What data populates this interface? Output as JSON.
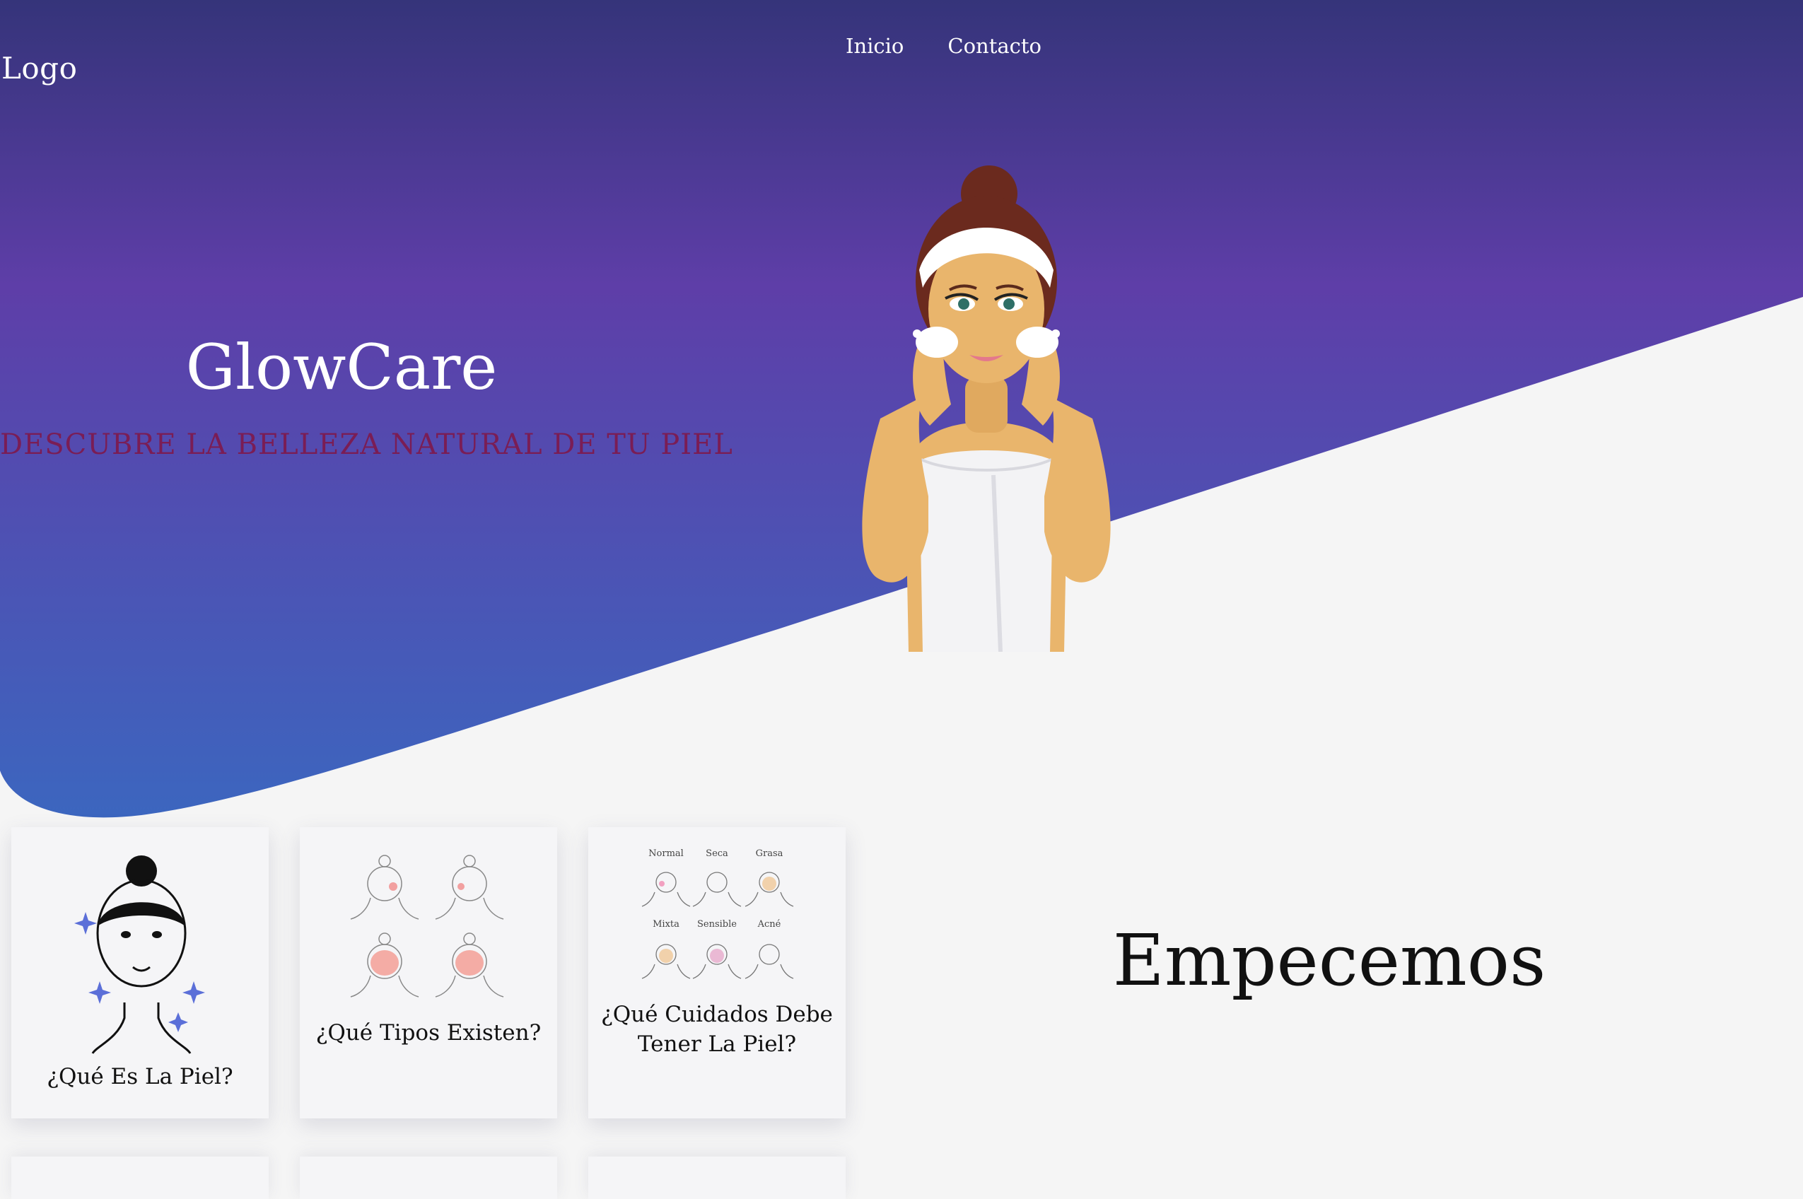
{
  "header": {
    "logo": "Logo",
    "nav": [
      "Inicio",
      "Contacto"
    ]
  },
  "hero": {
    "title": "GlowCare",
    "tagline": "DESCUBRE LA BELLEZA NATURAL DE TU PIEL",
    "illustration": "woman-washing-face"
  },
  "cards": [
    {
      "title": "¿Qué Es La Piel?",
      "icon": "face-sparkle-icon"
    },
    {
      "title": "¿Qué Tipos Existen?",
      "icon": "skin-types-faces-icon"
    },
    {
      "title": "¿Qué Cuidados Debe Tener La Piel?",
      "icon": "skin-care-chart-icon",
      "chart_labels": [
        "Normal",
        "Seca",
        "Grasa",
        "Mixta",
        "Sensible",
        "Acné"
      ]
    }
  ],
  "section": {
    "heading": "Empecemos"
  },
  "colors": {
    "gradient_top": "#35347a",
    "gradient_mid": "#5e3ea8",
    "gradient_bottom": "#3c66bf",
    "background": "#f5f5f5",
    "tagline": "#7a1d55",
    "text_dark": "#111111"
  }
}
